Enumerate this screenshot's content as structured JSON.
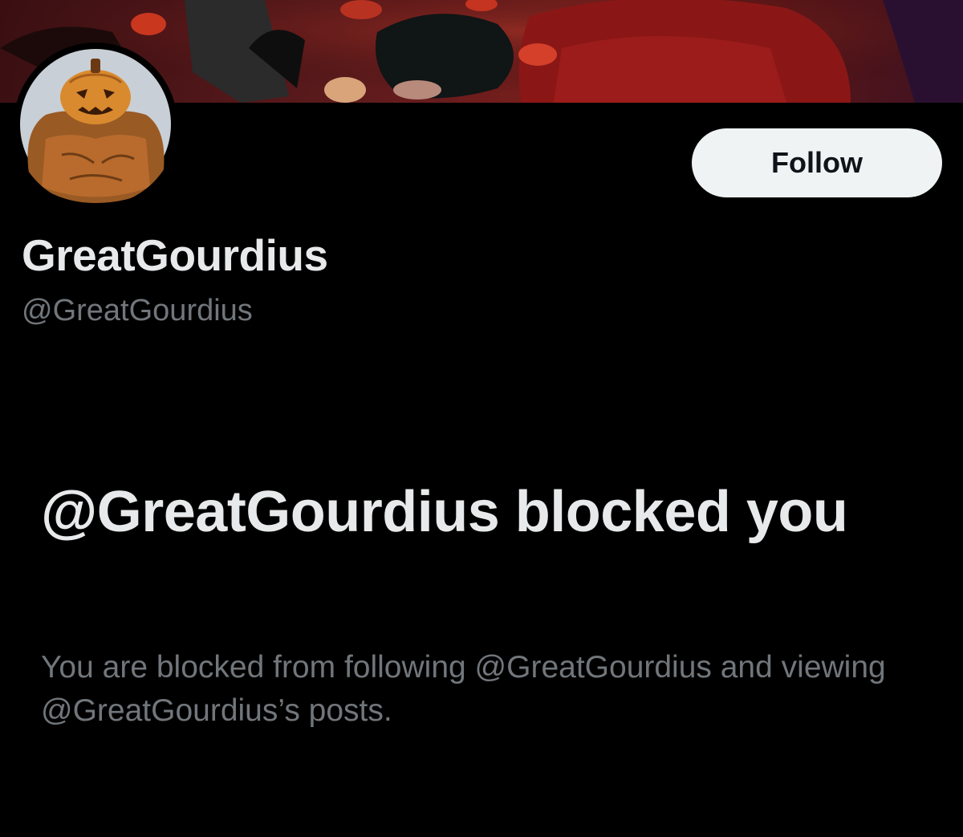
{
  "profile": {
    "display_name": "GreatGourdius",
    "handle": "@GreatGourdius",
    "follow_label": "Follow",
    "banner_icon": "banner-artwork",
    "avatar_icon": "pumpkin-avatar"
  },
  "blocked": {
    "title": "@GreatGourdius blocked you",
    "description": "You are blocked from following @GreatGourdius and viewing @GreatGourdius’s posts."
  },
  "colors": {
    "background": "#000000",
    "primary_text": "#e7e9ea",
    "secondary_text": "#71767b",
    "button_bg": "#eff3f4",
    "button_text": "#0f1419"
  }
}
